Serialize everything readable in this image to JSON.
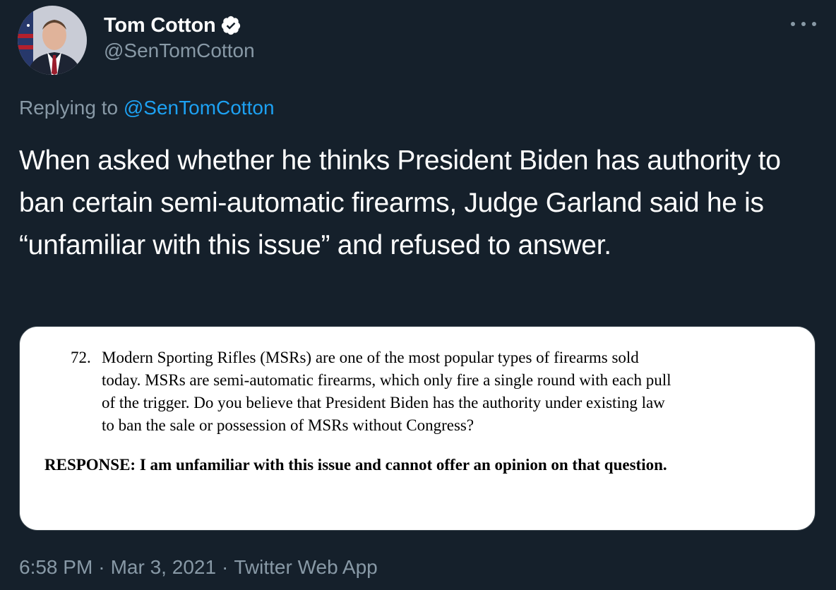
{
  "author": {
    "display_name": "Tom Cotton",
    "handle": "@SenTomCotton",
    "verified": true,
    "avatar_icon": "profile-photo"
  },
  "reply": {
    "prefix": "Replying to",
    "mention": "@SenTomCotton"
  },
  "tweet": {
    "text": "When asked whether he thinks President Biden has authority to ban certain semi-automatic firearms, Judge Garland said he is “unfamiliar with this issue” and refused to answer."
  },
  "media": {
    "question_number": "72.",
    "question_lines": [
      "Modern Sporting Rifles (MSRs) are one of the most popular types of firearms sold",
      "today. MSRs are semi-automatic firearms, which only fire a single round with each pull",
      "of the trigger. Do you believe that President Biden has the authority under existing law",
      "to ban the sale or possession of MSRs without Congress?"
    ],
    "response": "RESPONSE: I am unfamiliar with this issue and cannot offer an opinion on that question."
  },
  "meta": {
    "time": "6:58 PM",
    "separator": "·",
    "date": "Mar 3, 2021",
    "source": "Twitter Web App"
  },
  "colors": {
    "background": "#15202b",
    "secondary_text": "#8899a6",
    "link": "#1da1f2",
    "primary_text": "#ffffff"
  }
}
